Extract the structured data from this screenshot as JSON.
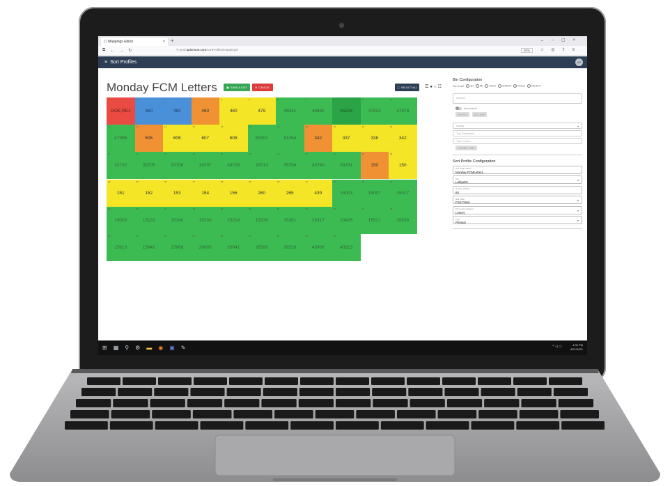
{
  "browser": {
    "tab_title": "Mappings Editor",
    "url_prefix": "prod.",
    "url_domain": "apiensort.com",
    "url_path": "/sortProfiles/mappings/",
    "zoom": "80%"
  },
  "appbar": {
    "title": "Sort Profiles",
    "avatar_initials": "AP"
  },
  "page": {
    "title": "Monday FCM Letters",
    "save_label": "SAVE & EXIT",
    "cancel_label": "CANCEL",
    "select_all_label": "SELECT ALL"
  },
  "grid": {
    "rows": [
      [
        {
          "n": "1",
          "v": "DOE,REJ",
          "c": "red"
        },
        {
          "n": "2",
          "v": "460",
          "c": "blue"
        },
        {
          "n": "3",
          "v": "460",
          "c": "blue"
        },
        {
          "n": "4",
          "v": "460",
          "c": "orange"
        },
        {
          "n": "5",
          "v": "460",
          "c": "yellow"
        },
        {
          "n": "6",
          "v": "479",
          "c": "yellow"
        },
        {
          "n": "7",
          "v": "46041",
          "c": "green"
        },
        {
          "n": "8",
          "v": "46865",
          "c": "green"
        },
        {
          "n": "9",
          "v": "46226",
          "c": "dgreen"
        },
        {
          "n": "10",
          "v": "47933",
          "c": "green"
        },
        {
          "n": "11",
          "v": "47978",
          "c": "green"
        }
      ],
      [
        {
          "n": "12",
          "v": "47996",
          "c": "green"
        },
        {
          "n": "13",
          "v": "606",
          "c": "orange"
        },
        {
          "n": "14",
          "v": "606",
          "c": "yellow"
        },
        {
          "n": "15",
          "v": "607",
          "c": "yellow"
        },
        {
          "n": "16",
          "v": "608",
          "c": "yellow"
        },
        {
          "n": "17",
          "v": "60901",
          "c": "green"
        },
        {
          "n": "18",
          "v": "61264",
          "c": "green"
        },
        {
          "n": "19",
          "v": "342",
          "c": "orange"
        },
        {
          "n": "20",
          "v": "337",
          "c": "yellow"
        },
        {
          "n": "21",
          "v": "338",
          "c": "yellow"
        },
        {
          "n": "22",
          "v": "342",
          "c": "yellow"
        }
      ],
      [
        {
          "n": "23",
          "v": "33702",
          "c": "green"
        },
        {
          "n": "24",
          "v": "33705",
          "c": "green"
        },
        {
          "n": "25",
          "v": "33706",
          "c": "green"
        },
        {
          "n": "26",
          "v": "33707",
          "c": "green"
        },
        {
          "n": "27",
          "v": "33709",
          "c": "green"
        },
        {
          "n": "28",
          "v": "33713",
          "c": "green"
        },
        {
          "n": "29",
          "v": "35756",
          "c": "green"
        },
        {
          "n": "30",
          "v": "33760",
          "c": "green"
        },
        {
          "n": "31",
          "v": "33791",
          "c": "green"
        },
        {
          "n": "32",
          "v": "150",
          "c": "orange"
        },
        {
          "n": "33",
          "v": "150",
          "c": "yellow"
        }
      ],
      [
        {
          "n": "34",
          "v": "151",
          "c": "yellow"
        },
        {
          "n": "35",
          "v": "152",
          "c": "yellow"
        },
        {
          "n": "36",
          "v": "153",
          "c": "yellow"
        },
        {
          "n": "37",
          "v": "154",
          "c": "yellow"
        },
        {
          "n": "38",
          "v": "156",
          "c": "yellow"
        },
        {
          "n": "39",
          "v": "260",
          "c": "yellow"
        },
        {
          "n": "40",
          "v": "265",
          "c": "yellow"
        },
        {
          "n": "41",
          "v": "439",
          "c": "yellow"
        },
        {
          "n": "42",
          "v": "15003",
          "c": "green"
        },
        {
          "n": "43",
          "v": "15007",
          "c": "green"
        },
        {
          "n": "44",
          "v": "15017",
          "c": "green"
        }
      ],
      [
        {
          "n": "45",
          "v": "15025",
          "c": "green"
        },
        {
          "n": "46",
          "v": "15122",
          "c": "green"
        },
        {
          "n": "47",
          "v": "15140",
          "c": "green"
        },
        {
          "n": "48",
          "v": "15203",
          "c": "green"
        },
        {
          "n": "49",
          "v": "15214",
          "c": "green"
        },
        {
          "n": "50",
          "v": "15226",
          "c": "green"
        },
        {
          "n": "51",
          "v": "15301",
          "c": "green"
        },
        {
          "n": "52",
          "v": "15317",
          "c": "green"
        },
        {
          "n": "53",
          "v": "15425",
          "c": "green"
        },
        {
          "n": "54",
          "v": "15521",
          "c": "green"
        },
        {
          "n": "55",
          "v": "15536",
          "c": "green"
        }
      ],
      [
        {
          "n": "56",
          "v": "15613",
          "c": "green"
        },
        {
          "n": "57",
          "v": "15642",
          "c": "green"
        },
        {
          "n": "58",
          "v": "15668",
          "c": "green"
        },
        {
          "n": "59",
          "v": "26003",
          "c": "green"
        },
        {
          "n": "60",
          "v": "26041",
          "c": "green"
        },
        {
          "n": "61",
          "v": "26508",
          "c": "green"
        },
        {
          "n": "62",
          "v": "26520",
          "c": "green"
        },
        {
          "n": "63",
          "v": "43906",
          "c": "green"
        },
        {
          "n": "64",
          "v": "43913",
          "c": "green"
        }
      ]
    ]
  },
  "bin_config": {
    "title": "Bin Configuration",
    "sort_level_label": "Sort Level",
    "sort_levels": [
      "3D",
      "5D",
      "AADC",
      "MAADC",
      "Return",
      "REJECT"
    ],
    "scheme_placeholder": "Scheme",
    "automated_label": "Automated?",
    "apply_label": "APPLY",
    "clear_label": "CLEAR",
    "mailing_placeholder": "Mailing",
    "tray_destination_placeholder": "Tray Destination",
    "tray_content_placeholder": "Tray Content",
    "reset_tray_label": "RESET TRAY"
  },
  "profile_config": {
    "title": "Sort Profile Configuration",
    "fields": [
      {
        "label": "Sort Profile Name*",
        "value": "Monday FCMLetters",
        "dropdown": false
      },
      {
        "label": "Site",
        "value": "Lafayette",
        "dropdown": true
      },
      {
        "label": "Number Of Bins",
        "value": "64",
        "dropdown": false
      },
      {
        "label": "Mail Class",
        "value": "First Class",
        "dropdown": true
      },
      {
        "label": "Processing Category",
        "value": "Letters",
        "dropdown": true
      },
      {
        "label": "Type",
        "value": "Primary",
        "dropdown": true
      }
    ]
  },
  "taskbar": {
    "time": "4:00 PM",
    "date": "8/21/2021"
  },
  "colors": {
    "green": "#3dbb53",
    "yellow": "#f4e527",
    "orange": "#f09233",
    "red": "#e94a41",
    "blue": "#4a90d9",
    "appbar": "#2d3e54"
  }
}
